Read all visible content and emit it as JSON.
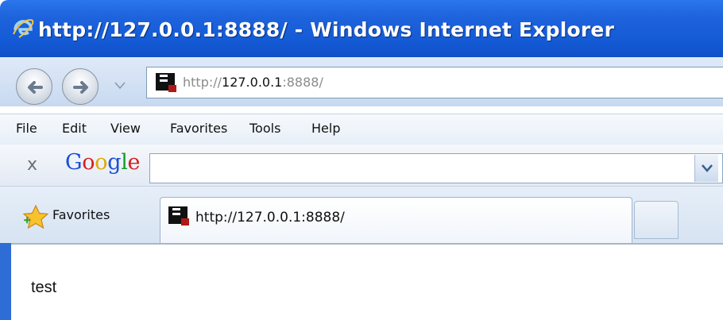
{
  "window": {
    "title": "http://127.0.0.1:8888/ - Windows Internet Explorer",
    "icon": "ie-logo-icon"
  },
  "address_bar": {
    "prefix": "http://",
    "host": "127.0.0.1",
    "port": ":8888/"
  },
  "menu": {
    "items": [
      "File",
      "Edit",
      "View",
      "Favorites",
      "Tools",
      "Help"
    ]
  },
  "google_toolbar": {
    "close_label": "x",
    "logo_letters": [
      "G",
      "o",
      "o",
      "g",
      "l",
      "e"
    ],
    "logo_colors": [
      "#1a4fd6",
      "#d81f1f",
      "#e2a800",
      "#1a4fd6",
      "#169c2b",
      "#d81f1f"
    ],
    "search_value": ""
  },
  "favorites_bar": {
    "favorites_label": "Favorites"
  },
  "tabs": [
    {
      "title": "http://127.0.0.1:8888/"
    }
  ],
  "page": {
    "body_text": "test"
  },
  "colors": {
    "titlebar": "#1e63dc",
    "site_icon_accent": "#b01818"
  }
}
